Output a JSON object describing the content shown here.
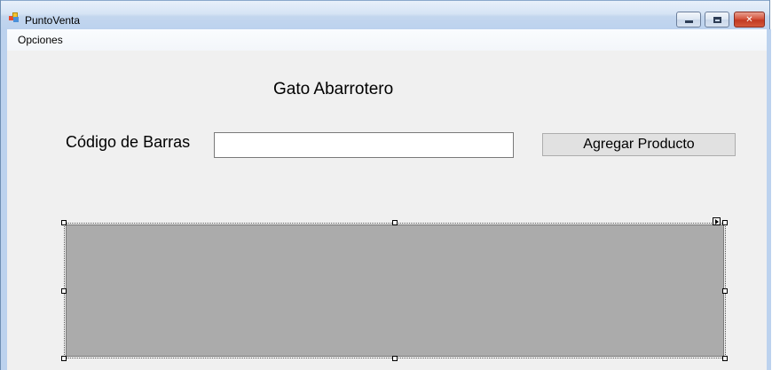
{
  "window": {
    "title": "PuntoVenta",
    "icon": "app-icon",
    "controls": {
      "minimize_icon": "minimize-icon",
      "maximize_icon": "maximize-icon",
      "close_icon": "close-icon",
      "close_glyph": "✕"
    }
  },
  "menubar": {
    "items": [
      {
        "label": "Opciones"
      }
    ]
  },
  "form": {
    "heading": "Gato Abarrotero",
    "barcode_label": "Código de Barras",
    "barcode_value": "",
    "add_button_label": "Agregar Producto"
  },
  "grid": {
    "background_color": "#ababab",
    "selected_in_designer": true
  }
}
